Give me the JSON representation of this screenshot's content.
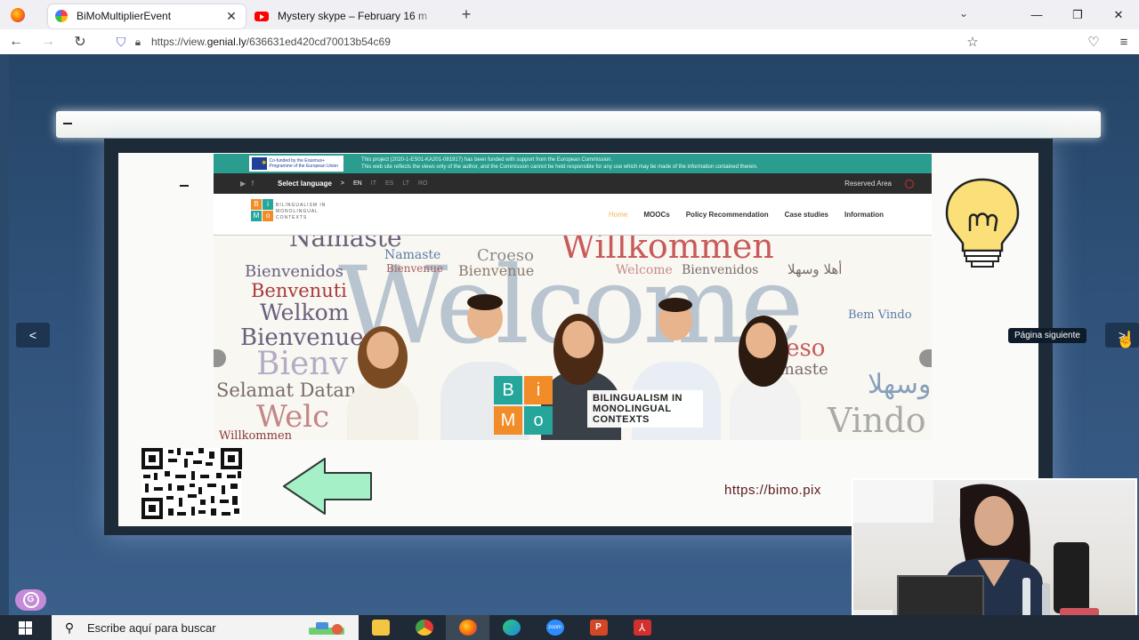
{
  "browser": {
    "tabs": [
      {
        "title": "BiMoMultiplierEvent",
        "active": true,
        "icon": "genially-icon"
      },
      {
        "title": "Mystery skype – February 16 m",
        "active": false,
        "icon": "youtube-icon"
      }
    ],
    "new_tab": "+",
    "url_prefix": "https://view.",
    "url_host": "genial.ly",
    "url_path": "/636631ed420cd70013b54c69",
    "window_controls": {
      "minimize": "—",
      "restore": "❐",
      "close": "✕"
    }
  },
  "slide": {
    "eu_logo_text": "Co-funded by the Erasmus+ Programme of the European Union",
    "eu_disclaimer_1": "This project (2020-1-ES01-KA201-081917) has been funded with support from the European Commission.",
    "eu_disclaimer_2": "This web site reflects the views only of the author, and the Commission cannot be held responsible for any use which may be made of the information contained therein.",
    "select_language": "Select language",
    "lang_arrow": ">",
    "languages": [
      "EN",
      "IT",
      "ES",
      "LT",
      "RO"
    ],
    "reserved_area": "Reserved Area",
    "brand_small": "BILINGUALISM IN MONOLINGUAL CONTEXTS",
    "bimo_letters": [
      "B",
      "i",
      "M",
      "o"
    ],
    "menu": [
      "Home",
      "MOOCs",
      "Policy Recommendation",
      "Case studies",
      "Information"
    ],
    "hero_words": {
      "namaste": "Namaste",
      "croeso": "Croeso",
      "bienvenue": "Bienvenue",
      "bienvenidos": "Bienvenidos",
      "benvenuti": "Benvenuti",
      "welkom": "Welkom",
      "bienvenue2": "Bienvenue",
      "selamat": "Selamat Datang",
      "welcome_small": "Welcome",
      "arabic": "أهلا وسهلا",
      "bem_vindo": "Bem Vindo",
      "willkommen": "Willkommen",
      "welcome_big": "Welcome",
      "willkommen_small": "Willkommen",
      "croeso2": "roeso",
      "namaste2": "amaste",
      "vindo": "Vindo",
      "bienvenidos2": "Bienvenidos",
      "welcome_mid": "Welc"
    },
    "bimo_label": "BILINGUALISM IN MONOLINGUAL CONTEXTS",
    "link_text": "https://bimo.pix"
  },
  "nav": {
    "prev": "<",
    "next": ">",
    "tooltip": "Página siguiente"
  },
  "taskbar": {
    "search_placeholder": "Escribe aquí para buscar",
    "apps": [
      "file-explorer",
      "chrome",
      "firefox",
      "edge",
      "zoom",
      "powerpoint",
      "acrobat"
    ],
    "zoom_label": "zoom"
  },
  "colors": {
    "teal": "#2a9d8f",
    "orange": "#f28c28",
    "bimo_teal": "#26a69a",
    "link": "#5a1a1a"
  }
}
